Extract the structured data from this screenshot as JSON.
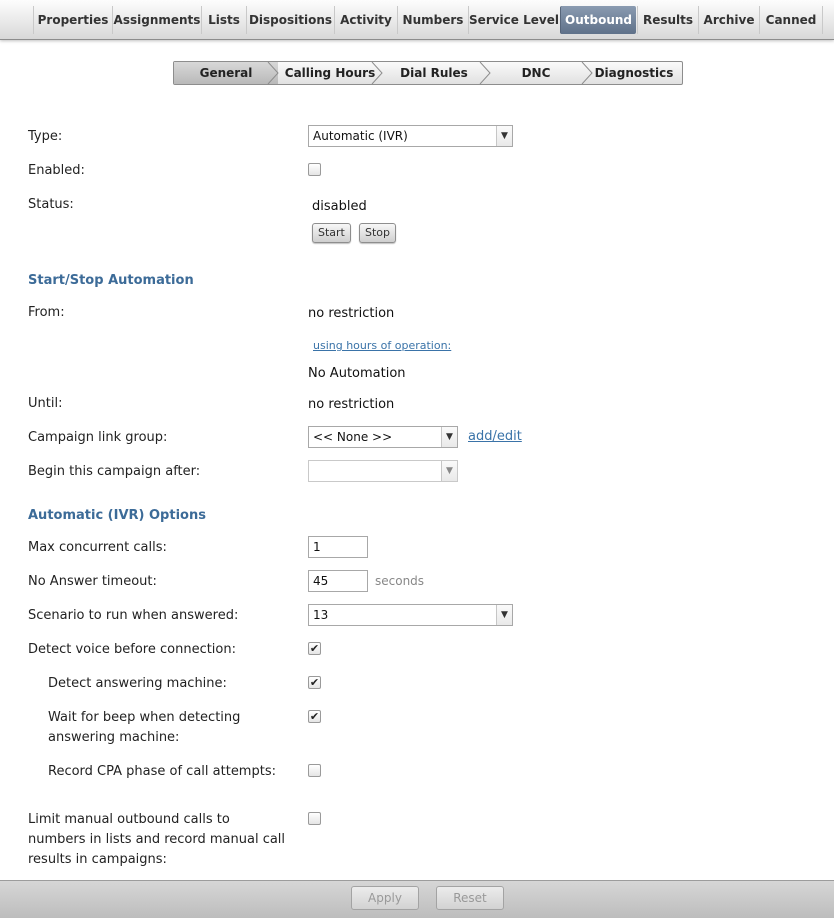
{
  "top_tabs": [
    {
      "label": "Properties"
    },
    {
      "label": "Assignments"
    },
    {
      "label": "Lists"
    },
    {
      "label": "Dispositions"
    },
    {
      "label": "Activity"
    },
    {
      "label": "Numbers"
    },
    {
      "label": "Service Level"
    },
    {
      "label": "Outbound",
      "active": true
    },
    {
      "label": "Results"
    },
    {
      "label": "Archive"
    },
    {
      "label": "Canned"
    }
  ],
  "sub_tabs": [
    {
      "label": "General",
      "active": true
    },
    {
      "label": "Calling Hours"
    },
    {
      "label": "Dial Rules"
    },
    {
      "label": "DNC"
    },
    {
      "label": "Diagnostics"
    }
  ],
  "general": {
    "type_label": "Type:",
    "type_value": "Automatic (IVR)",
    "enabled_label": "Enabled:",
    "enabled_checked": false,
    "status_label": "Status:",
    "status_value": "disabled",
    "start_label": "Start",
    "stop_label": "Stop"
  },
  "automation": {
    "title": "Start/Stop Automation",
    "from_label": "From:",
    "from_value": "no restriction",
    "hours_link": "using hours of operation:",
    "no_automation": "No Automation",
    "until_label": "Until:",
    "until_value": "no restriction",
    "link_group_label": "Campaign link group:",
    "link_group_value": "<< None >>",
    "add_edit_link": "add/edit",
    "begin_after_label": "Begin this campaign after:",
    "begin_after_value": ""
  },
  "ivr_options": {
    "title": "Automatic (IVR) Options",
    "max_calls_label": "Max concurrent calls:",
    "max_calls_value": "1",
    "no_answer_label": "No Answer timeout:",
    "no_answer_value": "45",
    "no_answer_unit": "seconds",
    "scenario_label": "Scenario to run when answered:",
    "scenario_value": "13",
    "detect_voice_label": "Detect voice before connection:",
    "detect_voice_checked": true,
    "detect_machine_label": "Detect answering machine:",
    "detect_machine_checked": true,
    "wait_beep_label_1": "Wait for beep when detecting",
    "wait_beep_label_2": "answering machine:",
    "wait_beep_checked": true,
    "record_cpa_label": "Record CPA phase of call attempts:",
    "record_cpa_checked": false,
    "limit_manual_label_1": "Limit manual outbound calls to",
    "limit_manual_label_2": "numbers in lists and record manual call",
    "limit_manual_label_3": "results in campaigns:",
    "limit_manual_checked": false
  },
  "footer": {
    "apply_label": "Apply",
    "reset_label": "Reset"
  },
  "icons": {
    "dropdown": "chevron-down-icon",
    "check": "checkmark-icon"
  },
  "colors": {
    "active_tab": "#6a7c93",
    "section_title": "#3c6b98",
    "link": "#3a73a8"
  }
}
